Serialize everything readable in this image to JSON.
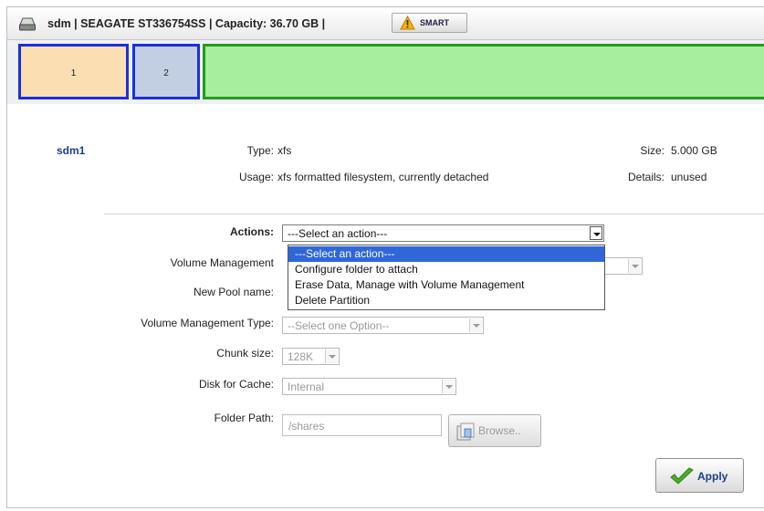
{
  "header": {
    "title": "sdm | SEAGATE  ST336754SS | Capacity: 36.70 GB |",
    "smart_label": "SMART"
  },
  "partitions": [
    {
      "label": "1"
    },
    {
      "label": "2"
    }
  ],
  "partition_info": {
    "name": "sdm1",
    "type_label": "Type:",
    "type_value": "xfs",
    "usage_label": "Usage:",
    "usage_value": "xfs formatted filesystem, currently detached",
    "size_label": "Size:",
    "size_value": "5.000 GB",
    "details_label": "Details:",
    "details_value": "unused"
  },
  "form": {
    "actions_label": "Actions:",
    "actions_value": "---Select an action---",
    "actions_options": [
      "---Select an action---",
      "Configure folder to attach",
      "Erase Data, Manage with Volume Management",
      "Delete Partition"
    ],
    "volume_mgmt_label": "Volume Management",
    "new_pool_label": "New Pool name:",
    "vm_type_label": "Volume Management Type:",
    "vm_type_value": "--Select one Option--",
    "chunk_label": "Chunk size:",
    "chunk_value": "128K",
    "cache_label": "Disk for Cache:",
    "cache_value": "Internal",
    "folder_label": "Folder Path:",
    "folder_placeholder": "/shares",
    "browse_label": "Browse..",
    "apply_label": "Apply"
  },
  "colors": {
    "partition1": "#fbdfb2",
    "partition2": "#c2cfe2",
    "free_space": "#a7ef9f",
    "selected_option": "#2f67d8"
  },
  "icons": [
    "disk-icon",
    "warning-icon",
    "folder-icon",
    "checkmark-icon",
    "chevron-down-icon"
  ]
}
